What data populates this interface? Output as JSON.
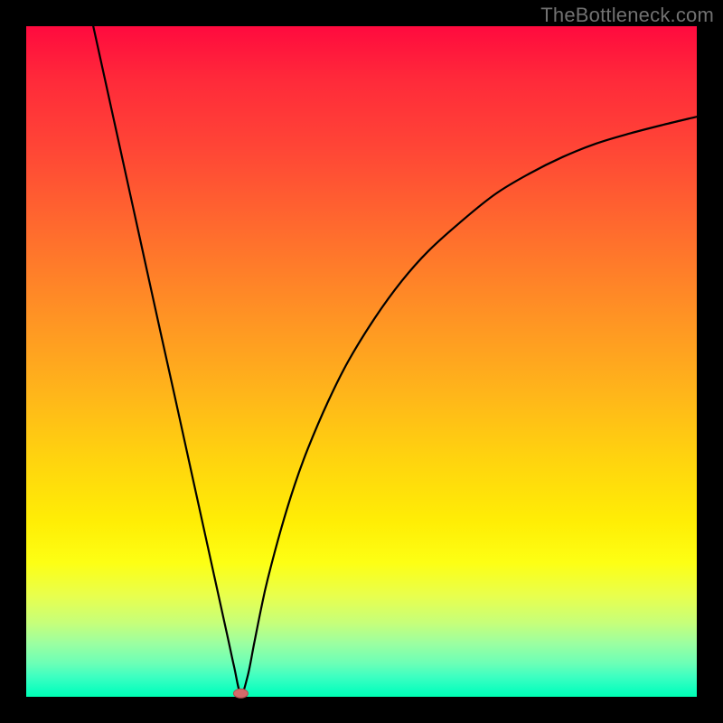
{
  "watermark": "TheBottleneck.com",
  "colors": {
    "frame": "#000000",
    "curve": "#000000",
    "marker_fill": "#d46a6a",
    "marker_stroke": "#b24a4a",
    "gradient_top": "#ff0a3e",
    "gradient_bottom": "#00ffb3"
  },
  "chart_data": {
    "type": "line",
    "title": "",
    "xlabel": "",
    "ylabel": "",
    "xlim": [
      0,
      100
    ],
    "ylim": [
      0,
      100
    ],
    "grid": false,
    "series": [
      {
        "name": "bottleneck-curve",
        "x": [
          10,
          12,
          14,
          16,
          18,
          20,
          22,
          24,
          26,
          28,
          30,
          31,
          32,
          33,
          34,
          35,
          36,
          38,
          40,
          42,
          45,
          48,
          52,
          56,
          60,
          65,
          70,
          75,
          80,
          85,
          90,
          95,
          100
        ],
        "y": [
          100,
          90.9,
          81.8,
          72.7,
          63.6,
          54.5,
          45.5,
          36.4,
          27.3,
          18.2,
          9.1,
          4.5,
          0.5,
          3.0,
          8.0,
          13.0,
          17.5,
          25.0,
          31.5,
          37.0,
          44.0,
          50.0,
          56.5,
          62.0,
          66.5,
          71.0,
          75.0,
          78.0,
          80.5,
          82.5,
          84.0,
          85.3,
          86.5
        ]
      }
    ],
    "marker": {
      "x": 32,
      "y": 0.5
    }
  }
}
